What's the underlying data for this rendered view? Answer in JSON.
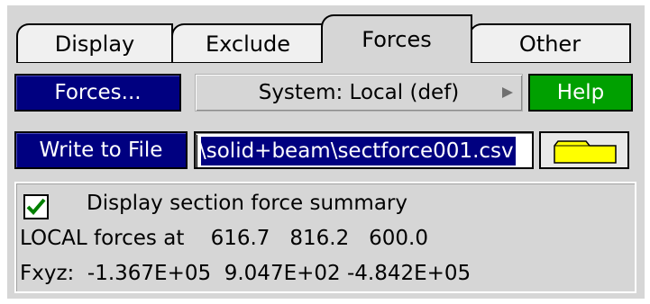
{
  "tabs": [
    {
      "label": "Display"
    },
    {
      "label": "Exclude"
    },
    {
      "label": "Forces",
      "active": true
    },
    {
      "label": "Other"
    }
  ],
  "forces_button": {
    "label": "Forces..."
  },
  "system_dropdown": {
    "selected": "System: Local (def)"
  },
  "help_button": {
    "label": "Help"
  },
  "write_button": {
    "label": "Write to File"
  },
  "filename_field": {
    "value": "\\solid+beam\\sectforce001.csv"
  },
  "folder_button": {
    "icon": "folder-icon"
  },
  "summary": {
    "checkbox_checked": true,
    "checkbox_label": "Display section force summary",
    "local_forces": "LOCAL forces at    616.7   816.2   600.0",
    "fxyz": "Fxyz:  -1.367E+05  9.047E+02 -4.842E+05"
  },
  "colors": {
    "panel_bg": "#d6d6d6",
    "navy": "#000080",
    "help_green": "#00a000",
    "folder_yellow": "#ffff00",
    "check_green": "#008000"
  }
}
